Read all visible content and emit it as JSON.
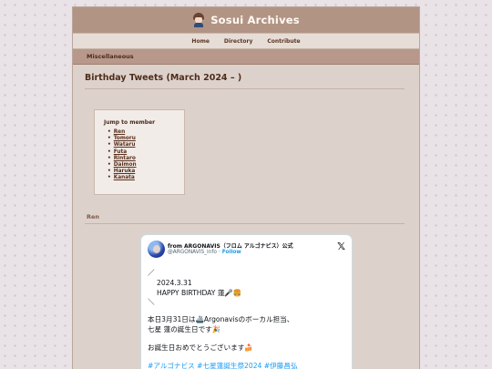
{
  "site": {
    "title": "Sosui Archives"
  },
  "nav": {
    "items": [
      "Home",
      "Directory",
      "Contribute"
    ]
  },
  "category": "Miscellaneous",
  "page": {
    "title": "Birthday Tweets (March 2024 – )"
  },
  "jump": {
    "heading": "Jump to member",
    "members": [
      "Ren",
      "Tomoru",
      "Wataru",
      "Futa",
      "Rintaro",
      "Daimon",
      "Haruka",
      "Kanata"
    ]
  },
  "section": {
    "title": "Ren"
  },
  "tweet": {
    "name": "from ARGONAVIS（フロム アルゴナビス）公式",
    "handle": "@ARGONAVIS_info",
    "dot": "·",
    "follow": "Follow",
    "x_logo": "𝕏",
    "lines": {
      "slash_top": "／",
      "date": "2024.3.31",
      "happy": "HAPPY BIRTHDAY 蓮🎤🍔",
      "slash_bottom": "＼",
      "line1": "本日3月31日は🚢Argonavisのボーカル担当、",
      "line2": "七星 蓮の誕生日です🎉",
      "line3": "お誕生日おめでとうございます🍰"
    },
    "hashtags": [
      "#アルゴナビス",
      "#七星蓮誕生祭2024",
      "#伊藤昌弘"
    ]
  }
}
